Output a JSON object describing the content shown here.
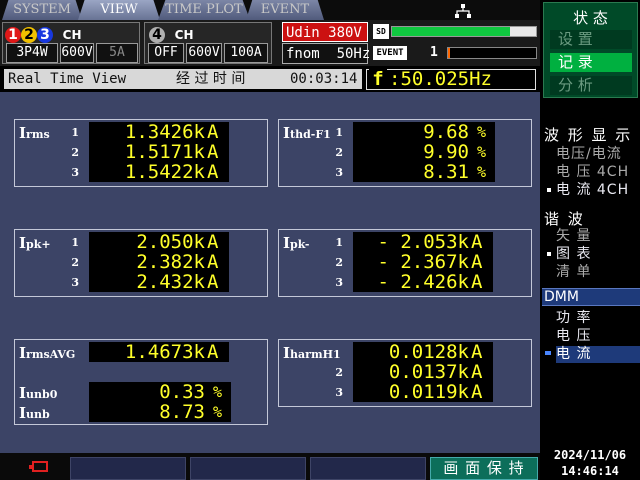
{
  "tabs": [
    {
      "label": "SYSTEM",
      "active": false
    },
    {
      "label": "VIEW",
      "active": true
    },
    {
      "label": "TIME PLOT",
      "active": false
    },
    {
      "label": "EVENT",
      "active": false
    }
  ],
  "status": {
    "ch_group1": {
      "n1": "1",
      "n2": "2",
      "n3": "3",
      "suffix": "CH",
      "wiring": "3P4W",
      "voltage": "600V",
      "current": "5A"
    },
    "ch_group2": {
      "n4": "4",
      "suffix": "CH",
      "wiring": "OFF",
      "voltage": "600V",
      "current": "100A"
    },
    "udin": "Udin 380V",
    "fnom": "fnom  50Hz",
    "sd_label": "SD",
    "event_label": "EVENT",
    "event_count": "1",
    "sd_level_pct": 82
  },
  "info": {
    "view_name": "Real Time View",
    "elapsed_label": "经 过 时 间",
    "elapsed_time": "00:03:14",
    "freq_label": "f",
    "freq_value": ":50.025Hz"
  },
  "measurements": {
    "irms": {
      "label_main": "I",
      "label_sub": "rms",
      "rows": [
        {
          "ch": "1",
          "value": "1.3426k",
          "unit": "A"
        },
        {
          "ch": "2",
          "value": "1.5171k",
          "unit": "A"
        },
        {
          "ch": "3",
          "value": "1.5422k",
          "unit": "A"
        }
      ]
    },
    "ithd": {
      "label_main": "I",
      "label_sub": "thd-F1",
      "rows": [
        {
          "ch": "1",
          "value": "9.68",
          "unit": "%"
        },
        {
          "ch": "2",
          "value": "9.90",
          "unit": "%"
        },
        {
          "ch": "3",
          "value": "8.31",
          "unit": "%"
        }
      ]
    },
    "ipkp": {
      "label_main": "I",
      "label_sub": "pk+",
      "rows": [
        {
          "ch": "1",
          "value": "2.050k",
          "unit": "A"
        },
        {
          "ch": "2",
          "value": "2.382k",
          "unit": "A"
        },
        {
          "ch": "3",
          "value": "2.432k",
          "unit": "A"
        }
      ]
    },
    "ipkm": {
      "label_main": "I",
      "label_sub": "pk-",
      "rows": [
        {
          "ch": "1",
          "value": "- 2.053k",
          "unit": "A"
        },
        {
          "ch": "2",
          "value": "- 2.367k",
          "unit": "A"
        },
        {
          "ch": "3",
          "value": "- 2.426k",
          "unit": "A"
        }
      ]
    },
    "irmsavg": {
      "label_main": "I",
      "label_sub": "rmsAVG",
      "value": "1.4673k",
      "unit": "A"
    },
    "iunb0": {
      "label_main": "I",
      "label_sub": "unb0",
      "value": "0.33",
      "unit": "%"
    },
    "iunb": {
      "label_main": "I",
      "label_sub": "unb",
      "value": "8.73",
      "unit": "%"
    },
    "iharm": {
      "label_main": "I",
      "label_sub": "harmH1",
      "rows": [
        {
          "ch": "1",
          "value": "0.0128k",
          "unit": "A"
        },
        {
          "ch": "2",
          "value": "0.0137k",
          "unit": "A"
        },
        {
          "ch": "3",
          "value": "0.0119k",
          "unit": "A"
        }
      ]
    }
  },
  "bottom": {
    "hold_button": "画 面 保 持"
  },
  "sidebar": {
    "menu_title": "状 态",
    "menu": [
      {
        "label": "设 置",
        "state": "normal"
      },
      {
        "label": "记 录",
        "state": "selected"
      },
      {
        "label": "分 析",
        "state": "normal"
      }
    ],
    "waveform_title": "波 形 显 示",
    "waveform_items": [
      {
        "label": "电压/电流",
        "selected": false
      },
      {
        "label": "电 压 4CH",
        "selected": false
      },
      {
        "label": "电 流 4CH",
        "selected": true
      }
    ],
    "harmonic_title": "谐 波",
    "harmonic_items": [
      {
        "label": "矢 量",
        "selected": false
      },
      {
        "label": "图 表",
        "selected": true
      },
      {
        "label": "清 单",
        "selected": false
      }
    ],
    "dmm_title": "DMM",
    "dmm_items": [
      {
        "label": "功 率",
        "selected": false
      },
      {
        "label": "电 压",
        "selected": false
      },
      {
        "label": "电 流",
        "selected": true
      }
    ],
    "date": "2024/11/06",
    "time": "14:46:14"
  },
  "colors": {
    "value_yellow": "#ffff2a",
    "panel_bg": "#3c4466",
    "udin_red": "#cc1111",
    "menu_green": "#00b040",
    "select_blue": "#1e3a7a"
  }
}
